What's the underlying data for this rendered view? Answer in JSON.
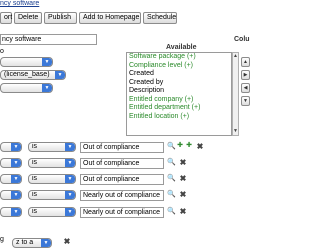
{
  "breadcrumb": "ncy software",
  "toolbar": {
    "buttons": [
      "ort",
      "Delete",
      "Publish",
      "Add to Homepage",
      "Schedule"
    ]
  },
  "report": {
    "title_value": "ncy software",
    "label_o": "o",
    "column_header": "Colu",
    "available_header": "Available"
  },
  "left_selects": [
    "",
    "(license_base)",
    ""
  ],
  "available_columns": [
    {
      "label": "Software package (+)",
      "color": "#2a8a2a"
    },
    {
      "label": "Compliance level (+)",
      "color": "#2a8a2a"
    },
    {
      "label": "Created",
      "color": "#000000"
    },
    {
      "label": "Created by",
      "color": "#000000"
    },
    {
      "label": "Description",
      "color": "#000000"
    },
    {
      "label": "Entitled company (+)",
      "color": "#2a8a2a"
    },
    {
      "label": "Entitled department (+)",
      "color": "#2a8a2a"
    },
    {
      "label": "Entitled location (+)",
      "color": "#2a8a2a"
    }
  ],
  "side_buttons": [
    "▲",
    "▶",
    "◀",
    "▼"
  ],
  "filters": [
    {
      "field": "",
      "operator": "is",
      "value": "Out of compliance"
    },
    {
      "field": "",
      "operator": "is",
      "value": "Out of compliance"
    },
    {
      "field": "",
      "operator": "is",
      "value": "Out of compliance"
    },
    {
      "field": "",
      "operator": "is",
      "value": "Nearly out of compliance"
    },
    {
      "field": "",
      "operator": "is",
      "value": "Nearly out of compliance"
    }
  ],
  "sort": {
    "label": "g",
    "direction": "z to a"
  }
}
